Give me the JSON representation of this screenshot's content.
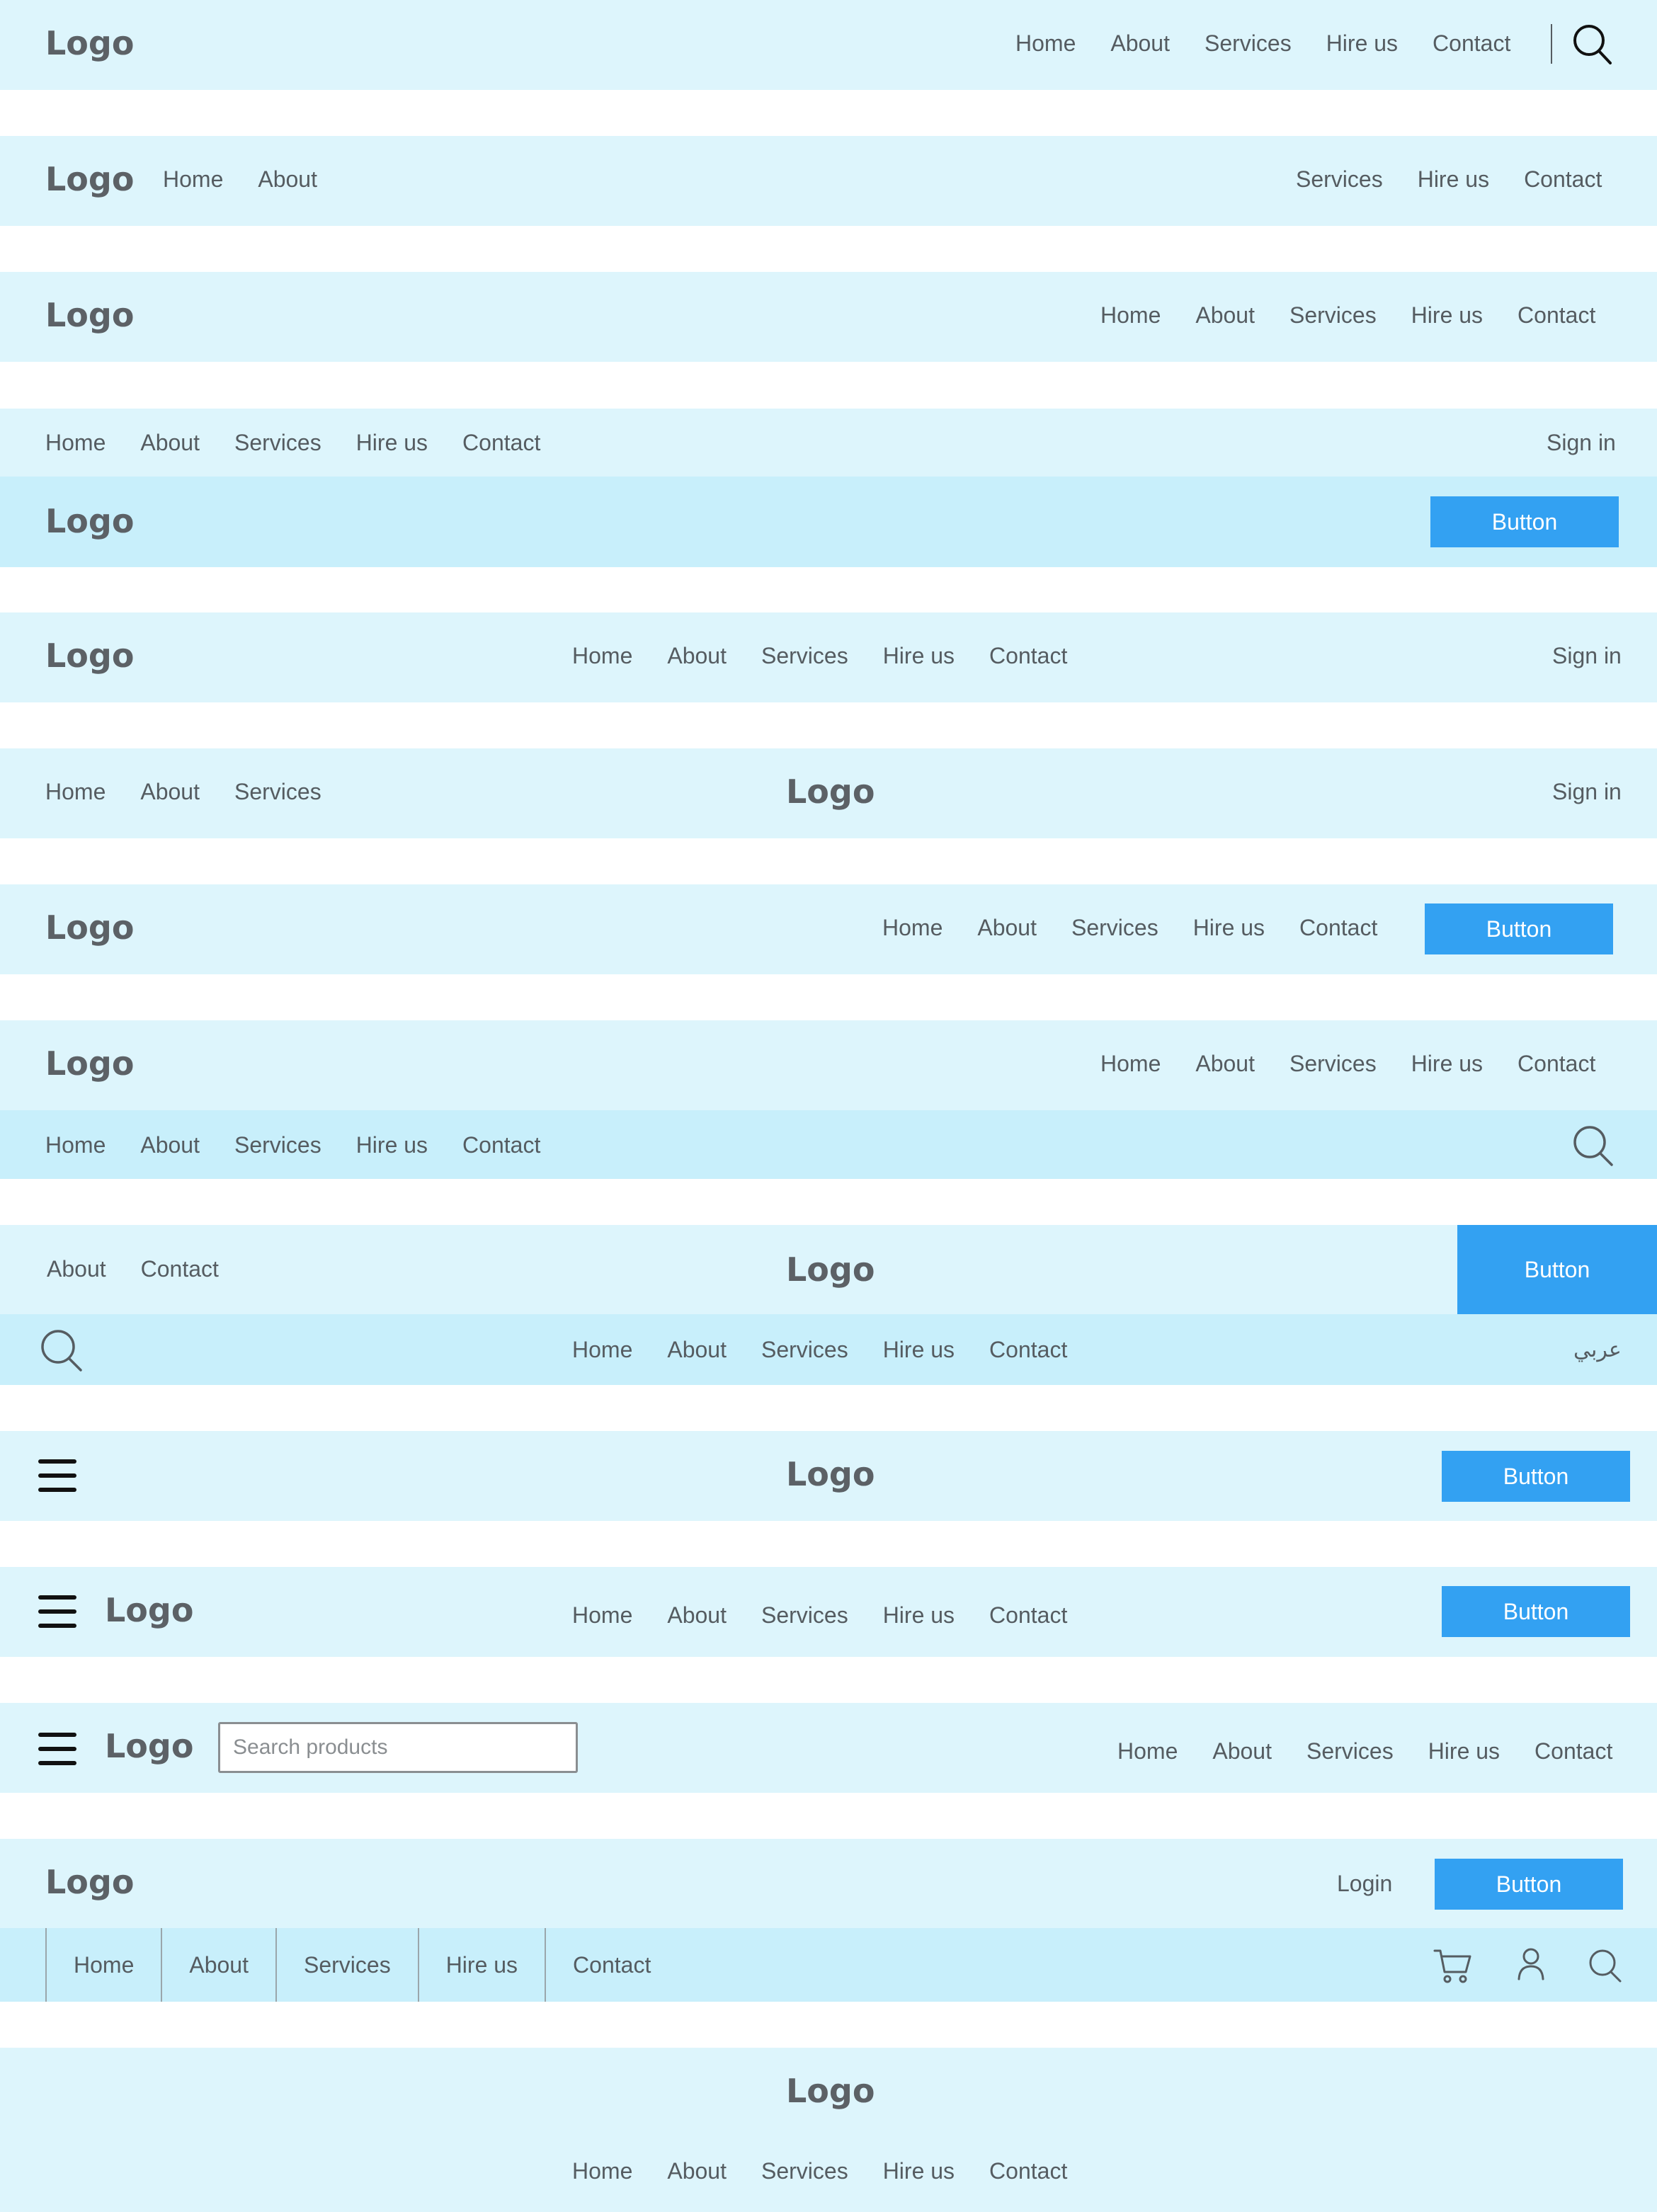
{
  "logo": "Logo",
  "button_label": "Button",
  "sign_in": "Sign in",
  "login": "Login",
  "arabic": "عربي",
  "search_placeholder": "Search products",
  "nav": {
    "home": "Home",
    "about": "About",
    "services": "Services",
    "hire": "Hire us",
    "contact": "Contact"
  },
  "colors": {
    "bar": "#ddf5fc",
    "bar_dark": "#c8effb",
    "button": "#33a1f2",
    "text": "#555c61"
  },
  "icons": [
    "search-icon",
    "hamburger-menu-icon",
    "cart-icon",
    "user-icon"
  ]
}
